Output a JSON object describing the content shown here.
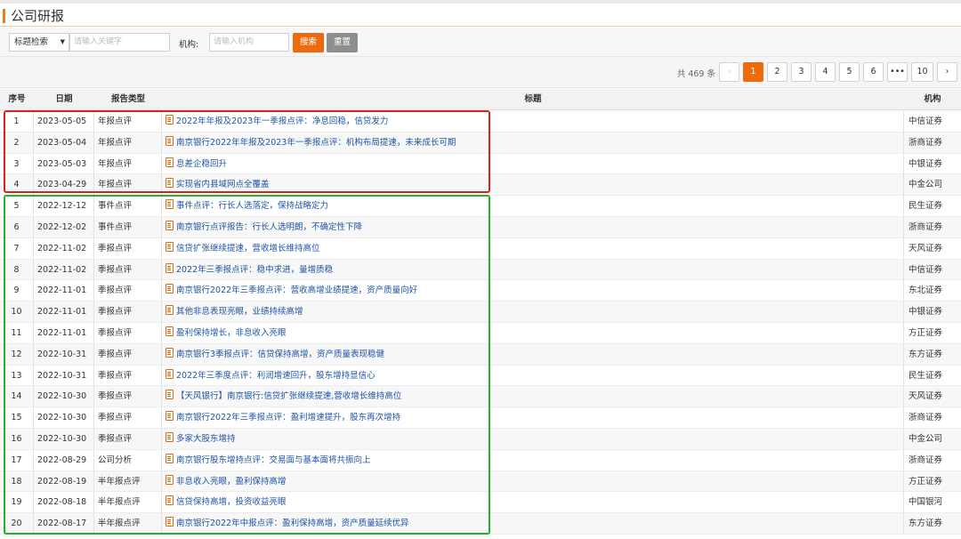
{
  "page": {
    "title": "公司研报"
  },
  "search": {
    "select_value": "标题检索",
    "keyword_placeholder": "请输入关键字",
    "org_label": "机构:",
    "org_placeholder": "请输入机构",
    "search_label": "搜索",
    "reset_label": "重置"
  },
  "pagination": {
    "total_text": "共 469 条",
    "prev": "‹",
    "next": "›",
    "pages": [
      "1",
      "2",
      "3",
      "4",
      "5",
      "6",
      "•••",
      "10"
    ],
    "current": "1"
  },
  "table": {
    "headers": {
      "idx": "序号",
      "date": "日期",
      "type": "报告类型",
      "title": "标题",
      "org": "机构"
    },
    "rows": [
      {
        "idx": "1",
        "date": "2023-05-05",
        "type": "年报点评",
        "title": "2022年年报及2023年一季报点评：净息回稳，信贷发力",
        "org": "中信证券"
      },
      {
        "idx": "2",
        "date": "2023-05-04",
        "type": "年报点评",
        "title": "南京银行2022年年报及2023年一季报点评：机构布局提速，未来成长可期",
        "org": "浙商证券"
      },
      {
        "idx": "3",
        "date": "2023-05-03",
        "type": "年报点评",
        "title": "息差企稳回升",
        "org": "中银证券"
      },
      {
        "idx": "4",
        "date": "2023-04-29",
        "type": "年报点评",
        "title": "实现省内县域网点全覆盖",
        "org": "中金公司"
      },
      {
        "idx": "5",
        "date": "2022-12-12",
        "type": "事件点评",
        "title": "事件点评：行长人选落定，保持战略定力",
        "org": "民生证券"
      },
      {
        "idx": "6",
        "date": "2022-12-02",
        "type": "事件点评",
        "title": "南京银行点评报告：行长人选明朗，不确定性下降",
        "org": "浙商证券"
      },
      {
        "idx": "7",
        "date": "2022-11-02",
        "type": "季报点评",
        "title": "信贷扩张继续提速，营收增长维持高位",
        "org": "天风证券"
      },
      {
        "idx": "8",
        "date": "2022-11-02",
        "type": "季报点评",
        "title": "2022年三季报点评：稳中求进，量增质稳",
        "org": "中信证券"
      },
      {
        "idx": "9",
        "date": "2022-11-01",
        "type": "季报点评",
        "title": "南京银行2022年三季报点评：营收高增业绩提速，资产质量向好",
        "org": "东北证券"
      },
      {
        "idx": "10",
        "date": "2022-11-01",
        "type": "季报点评",
        "title": "其他非息表现亮眼，业绩持续高增",
        "org": "中银证券"
      },
      {
        "idx": "11",
        "date": "2022-11-01",
        "type": "季报点评",
        "title": "盈利保持增长，非息收入亮眼",
        "org": "方正证券"
      },
      {
        "idx": "12",
        "date": "2022-10-31",
        "type": "季报点评",
        "title": "南京银行3季报点评：信贷保持高增，资产质量表现稳健",
        "org": "东方证券"
      },
      {
        "idx": "13",
        "date": "2022-10-31",
        "type": "季报点评",
        "title": "2022年三季度点评：利润增速回升，股东增持显信心",
        "org": "民生证券"
      },
      {
        "idx": "14",
        "date": "2022-10-30",
        "type": "季报点评",
        "title": "【天风银行】南京银行:信贷扩张继续提速,营收增长维持高位",
        "org": "天风证券"
      },
      {
        "idx": "15",
        "date": "2022-10-30",
        "type": "季报点评",
        "title": "南京银行2022年三季报点评：盈利增速提升，股东再次增持",
        "org": "浙商证券"
      },
      {
        "idx": "16",
        "date": "2022-10-30",
        "type": "季报点评",
        "title": "多家大股东增持",
        "org": "中金公司"
      },
      {
        "idx": "17",
        "date": "2022-08-29",
        "type": "公司分析",
        "title": "南京银行股东增持点评：交易面与基本面将共振向上",
        "org": "浙商证券"
      },
      {
        "idx": "18",
        "date": "2022-08-19",
        "type": "半年报点评",
        "title": "非息收入亮眼，盈利保持高增",
        "org": "方正证券"
      },
      {
        "idx": "19",
        "date": "2022-08-18",
        "type": "半年报点评",
        "title": "信贷保持高增，投资收益亮眼",
        "org": "中国银河"
      },
      {
        "idx": "20",
        "date": "2022-08-17",
        "type": "半年报点评",
        "title": "南京银行2022年中报点评：盈利保持高增，资产质量延续优异",
        "org": "东方证券"
      }
    ]
  },
  "colors": {
    "accent": "#ee6a0e",
    "link": "#1d55a6",
    "highlight_red": "#e02020",
    "highlight_green": "#23b02a"
  },
  "icons": {
    "row_icon": "document-icon"
  }
}
